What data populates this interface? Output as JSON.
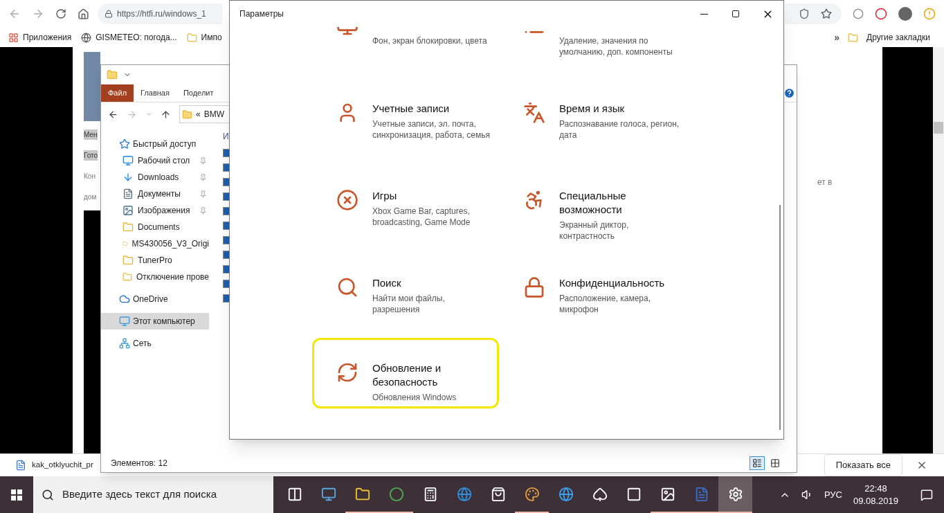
{
  "browser": {
    "address": "https://htfi.ru/windows_1",
    "bookmarks": [
      {
        "label": "Приложения",
        "kind": "apps"
      },
      {
        "label": "GISMETEO: погода...",
        "kind": "globe"
      },
      {
        "label": "Импо",
        "kind": "folder"
      }
    ],
    "overflow": "»",
    "other_bookmarks": "Другие закладки"
  },
  "page": {
    "left_fragments": [
      {
        "text": "Мен",
        "highlighted": true
      },
      {
        "text": "Гото",
        "highlighted": true
      },
      {
        "text": "Кон",
        "highlighted": false
      },
      {
        "text": "дом",
        "highlighted": false
      }
    ],
    "right_fragment": "ет в"
  },
  "download_bar": {
    "file": "kak_otklyuchit_pr",
    "show_all": "Показать все"
  },
  "explorer": {
    "tabs": [
      {
        "label": "Файл",
        "selected": true
      },
      {
        "label": "Главная",
        "selected": false
      },
      {
        "label": "Поделит",
        "selected": false
      }
    ],
    "address_prefix": "«",
    "address": "BMW",
    "column_header": "И",
    "nav": [
      {
        "label": "Быстрый доступ",
        "kind": "star",
        "selected": false,
        "children": [
          {
            "label": "Рабочий стол",
            "kind": "desktop",
            "pinned": true,
            "selected": false
          },
          {
            "label": "Downloads",
            "kind": "download",
            "pinned": true,
            "selected": false
          },
          {
            "label": "Документы",
            "kind": "document",
            "pinned": true,
            "selected": false
          },
          {
            "label": "Изображения",
            "kind": "image",
            "pinned": true,
            "selected": false
          },
          {
            "label": "Documents",
            "kind": "folder",
            "pinned": false,
            "selected": false
          },
          {
            "label": "MS430056_V3_Origi",
            "kind": "folder",
            "pinned": false,
            "selected": false
          },
          {
            "label": "TunerPro",
            "kind": "folder",
            "pinned": false,
            "selected": false
          },
          {
            "label": "Отключение прове",
            "kind": "folder",
            "pinned": false,
            "selected": false
          }
        ]
      },
      {
        "label": "OneDrive",
        "kind": "cloud",
        "selected": false
      },
      {
        "label": "Этот компьютер",
        "kind": "computer",
        "selected": true
      },
      {
        "label": "Сеть",
        "kind": "network",
        "selected": false
      }
    ],
    "status": "Элементов: 12",
    "views": [
      {
        "kind": "details",
        "selected": true
      },
      {
        "kind": "tiles",
        "selected": false
      }
    ]
  },
  "settings": {
    "title": "Параметры",
    "items": [
      {
        "kind": "personalization",
        "subtitle": "Фон, экран блокировки, цвета",
        "highlighted": false
      },
      {
        "kind": "apps",
        "subtitle": "Удаление, значения по умолчанию, доп. компоненты",
        "highlighted": false
      },
      {
        "kind": "accounts",
        "title": "Учетные записи",
        "subtitle": "Учетные записи, эл. почта, синхронизация, работа, семья",
        "highlighted": false
      },
      {
        "kind": "time",
        "title": "Время и язык",
        "subtitle": "Распознавание голоса, регион, дата",
        "highlighted": false
      },
      {
        "kind": "games",
        "title": "Игры",
        "subtitle": "Xbox Game Bar, captures, broadcasting, Game Mode",
        "highlighted": false
      },
      {
        "kind": "accessibility",
        "title": "Специальные возможности",
        "subtitle": "Экранный диктор, контрастность",
        "highlighted": false
      },
      {
        "kind": "search",
        "title": "Поиск",
        "subtitle": "Найти мои файлы, разрешения",
        "highlighted": false
      },
      {
        "kind": "privacy",
        "title": "Конфиденциальность",
        "subtitle": "Расположение, камера, микрофон",
        "highlighted": false
      },
      {
        "kind": "update",
        "title": "Обновление и безопасность",
        "subtitle": "Обновления Windows",
        "highlighted": true
      }
    ]
  },
  "taskbar": {
    "search_placeholder": "Введите здесь текст для поиска",
    "apps": [
      {
        "kind": "taskview",
        "running": false,
        "selected": false
      },
      {
        "kind": "computer",
        "running": false,
        "selected": false
      },
      {
        "kind": "explorer",
        "running": true,
        "selected": false
      },
      {
        "kind": "chrome",
        "running": true,
        "selected": false
      },
      {
        "kind": "calculator",
        "running": false,
        "selected": false
      },
      {
        "kind": "edge",
        "running": false,
        "selected": false
      },
      {
        "kind": "store",
        "running": false,
        "selected": false
      },
      {
        "kind": "paint",
        "running": true,
        "selected": false
      },
      {
        "kind": "ie",
        "running": false,
        "selected": false
      },
      {
        "kind": "cards",
        "running": false,
        "selected": false
      },
      {
        "kind": "mahjong",
        "running": false,
        "selected": false
      },
      {
        "kind": "photos",
        "running": true,
        "selected": false
      },
      {
        "kind": "word",
        "running": true,
        "selected": false
      },
      {
        "kind": "settings",
        "running": true,
        "selected": true
      }
    ],
    "language": "РУС",
    "time": "22:48",
    "date": "09.08.2019"
  }
}
